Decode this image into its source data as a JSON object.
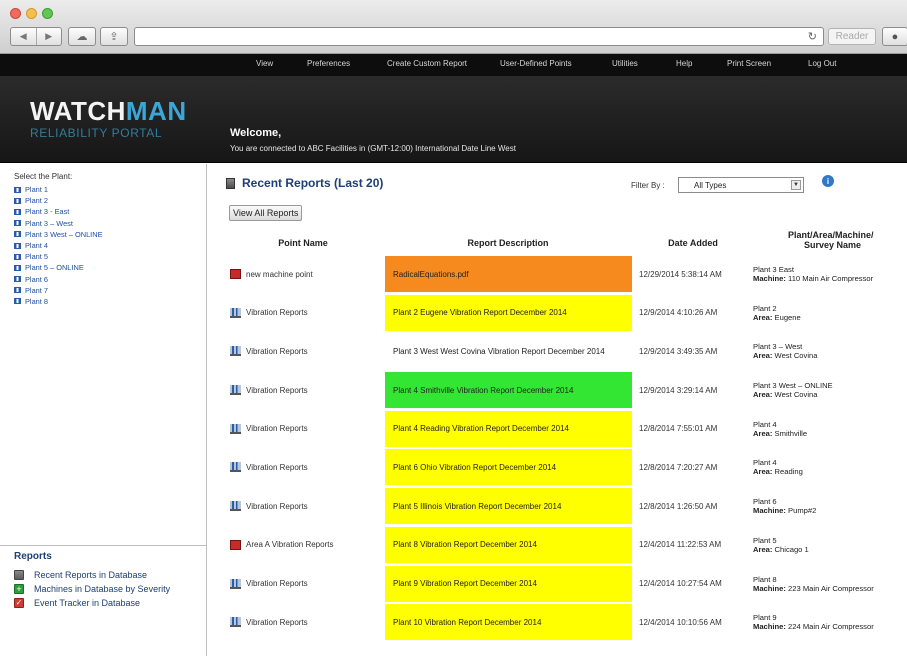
{
  "browser": {
    "reader_label": "Reader"
  },
  "topnav": {
    "items": [
      "View",
      "Preferences",
      "Create Custom Report",
      "User-Defined Points",
      "Utilities",
      "Help",
      "Print Screen",
      "Log Out"
    ]
  },
  "banner": {
    "logo_part1": "WATCH",
    "logo_part2": "MAN",
    "logo_sub": "RELIABILITY PORTAL",
    "welcome": "Welcome,",
    "connected": "You are connected to ABC Facilities in (GMT-12:00) International Date Line West"
  },
  "sidebar": {
    "select_label": "Select the Plant:",
    "plants": [
      "Plant 1",
      "Plant 2",
      "Plant 3 - East",
      "Plant 3 – West",
      "Plant 3 West – ONLINE",
      "Plant 4",
      "Plant 5",
      "Plant 5 – ONLINE",
      "Plant 6",
      "Plant 7",
      "Plant 8"
    ],
    "reports_title": "Reports",
    "report_links": [
      {
        "label": "Recent Reports in Database",
        "icon": "document-icon"
      },
      {
        "label": "Machines in Database by Severity",
        "icon": "plus-icon"
      },
      {
        "label": "Event Tracker in Database",
        "icon": "check-icon"
      }
    ]
  },
  "main": {
    "title": "Recent Reports (Last 20)",
    "view_all_label": "View All Reports",
    "filter_label": "Filter By :",
    "filter_value": "All Types",
    "columns": {
      "point": "Point Name",
      "desc": "Report Description",
      "date": "Date Added",
      "loc_line1": "Plant/Area/Machine/",
      "loc_line2": "Survey Name"
    },
    "colors": {
      "orange": "#f68a1e",
      "yellow": "#ffff00",
      "green": "#33e633",
      "white": "#ffffff"
    },
    "rows": [
      {
        "point": "new machine point",
        "icon": "pdf",
        "desc": "RadicalEquations.pdf",
        "color": "orange",
        "date": "12/29/2014 5:38:14 AM",
        "loc1": "Plant 3 East",
        "loc_kind": "Machine:",
        "loc_val": "110 Main Air Compressor"
      },
      {
        "point": "Vibration Reports",
        "icon": "chart",
        "desc": "Plant 2 Eugene Vibration Report December 2014",
        "color": "yellow",
        "date": "12/9/2014 4:10:26 AM",
        "loc1": "Plant 2",
        "loc_kind": "Area:",
        "loc_val": "Eugene"
      },
      {
        "point": "Vibration Reports",
        "icon": "chart",
        "desc": "Plant 3 West West Covina Vibration Report December 2014",
        "color": "white",
        "date": "12/9/2014 3:49:35 AM",
        "loc1": "Plant 3 – West",
        "loc_kind": "Area:",
        "loc_val": "West Covina"
      },
      {
        "point": "Vibration Reports",
        "icon": "chart",
        "desc": "Plant 4 Smithville Vibration Report December 2014",
        "color": "green",
        "date": "12/9/2014 3:29:14 AM",
        "loc1": "Plant 3 West – ONLINE",
        "loc_kind": "Area:",
        "loc_val": "West Covina"
      },
      {
        "point": "Vibration Reports",
        "icon": "chart",
        "desc": "Plant 4 Reading Vibration Report December 2014",
        "color": "yellow",
        "date": "12/8/2014 7:55:01 AM",
        "loc1": "Plant 4",
        "loc_kind": "Area:",
        "loc_val": "Smithville"
      },
      {
        "point": "Vibration Reports",
        "icon": "chart",
        "desc": "Plant 6 Ohio Vibration Report December 2014",
        "color": "yellow",
        "date": "12/8/2014 7:20:27 AM",
        "loc1": "Plant 4",
        "loc_kind": "Area:",
        "loc_val": "Reading"
      },
      {
        "point": "Vibration Reports",
        "icon": "chart",
        "desc": "Plant 5 Illinois Vibration Report December 2014",
        "color": "yellow",
        "date": "12/8/2014 1:26:50 AM",
        "loc1": "Plant 6",
        "loc_kind": "Machine:",
        "loc_val": "Pump#2"
      },
      {
        "point": "Area A Vibration Reports",
        "icon": "pdf",
        "desc": "Plant 8 Vibration Report December 2014",
        "color": "yellow",
        "date": "12/4/2014 11:22:53 AM",
        "loc1": "Plant 5",
        "loc_kind": "Area:",
        "loc_val": "Chicago 1"
      },
      {
        "point": "Vibration Reports",
        "icon": "chart",
        "desc": "Plant 9 Vibration Report December 2014",
        "color": "yellow",
        "date": "12/4/2014 10:27:54 AM",
        "loc1": "Plant 8",
        "loc_kind": "Machine:",
        "loc_val": "223 Main Air Compressor"
      },
      {
        "point": "Vibration Reports",
        "icon": "chart",
        "desc": "Plant 10 Vibration Report December 2014",
        "color": "yellow",
        "date": "12/4/2014 10:10:56 AM",
        "loc1": "Plant 9",
        "loc_kind": "Machine:",
        "loc_val": "224 Main Air Compressor"
      }
    ]
  }
}
